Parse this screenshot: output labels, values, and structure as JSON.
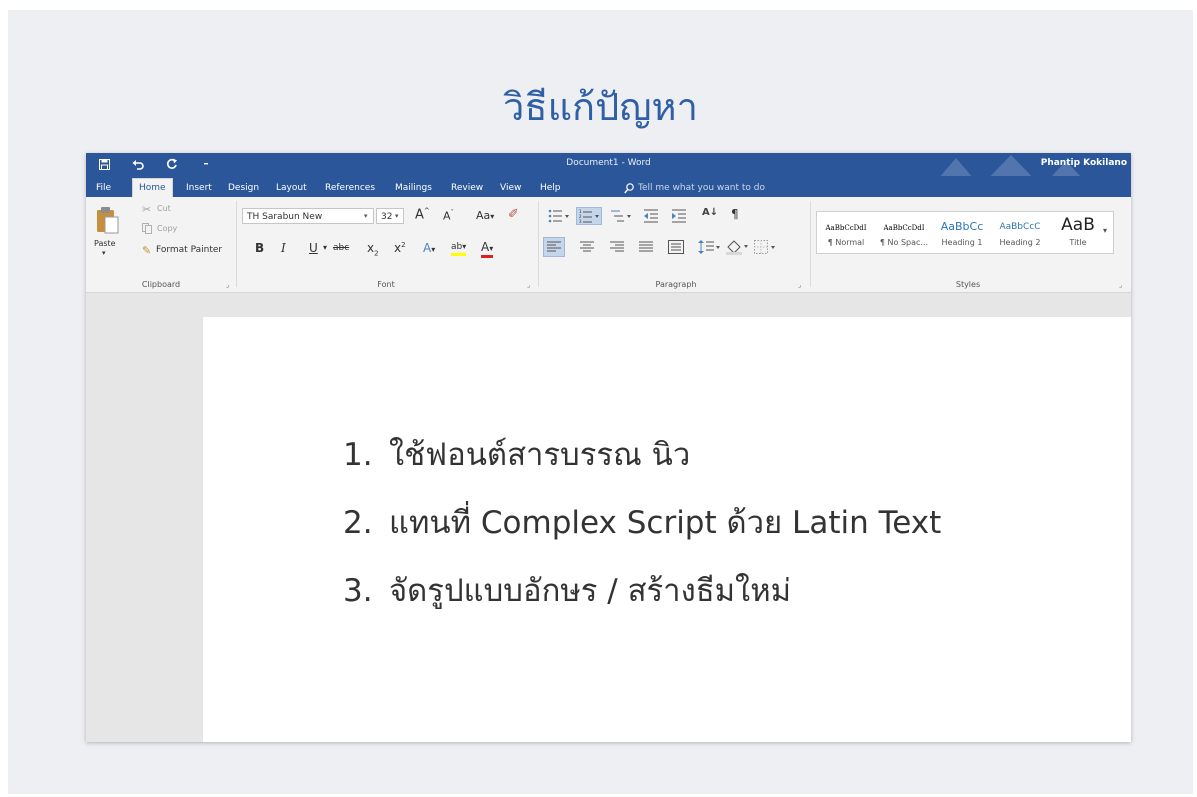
{
  "slide": {
    "title": "วิธีแก้ปัญหา"
  },
  "window": {
    "document_title": "Document1  -  Word",
    "user": "Phantip Kokilano"
  },
  "tabs": [
    {
      "label": "File"
    },
    {
      "label": "Home"
    },
    {
      "label": "Insert"
    },
    {
      "label": "Design"
    },
    {
      "label": "Layout"
    },
    {
      "label": "References"
    },
    {
      "label": "Mailings"
    },
    {
      "label": "Review"
    },
    {
      "label": "View"
    },
    {
      "label": "Help"
    }
  ],
  "tell_me": "Tell me what you want to do",
  "clipboard": {
    "paste": "Paste",
    "cut": "Cut",
    "copy": "Copy",
    "format_painter": "Format Painter",
    "group": "Clipboard"
  },
  "font": {
    "name": "TH Sarabun New",
    "size": "32",
    "grow": "A",
    "shrink": "A",
    "change_case": "Aa",
    "bold": "B",
    "italic": "I",
    "underline": "U",
    "strike": "abc",
    "subscript": "x",
    "superscript": "x",
    "text_effects": "A",
    "highlight": "ab",
    "font_color": "A",
    "group": "Font"
  },
  "paragraph": {
    "group": "Paragraph",
    "pilcrow": "¶"
  },
  "styles": {
    "group": "Styles",
    "items": [
      {
        "sample": "AaBbCcDdI",
        "name": "¶ Normal"
      },
      {
        "sample": "AaBbCcDdI",
        "name": "¶ No Spac..."
      },
      {
        "sample": "AaBbCc",
        "name": "Heading 1"
      },
      {
        "sample": "AaBbCcC",
        "name": "Heading 2"
      },
      {
        "sample": "AaB",
        "name": "Title"
      }
    ]
  },
  "document": {
    "lines": [
      {
        "num": "1.",
        "text": "ใช้ฟอนต์สารบรรณ นิว"
      },
      {
        "num": "2.",
        "text": "แทนที่ Complex Script ด้วย Latin Text"
      },
      {
        "num": "3.",
        "text": "จัดรูปแบบอักษร / สร้างธีมใหม่"
      }
    ]
  },
  "colors": {
    "word_blue": "#2b579a",
    "slide_bg": "#eeeff3",
    "title_blue": "#2f5fa6"
  }
}
